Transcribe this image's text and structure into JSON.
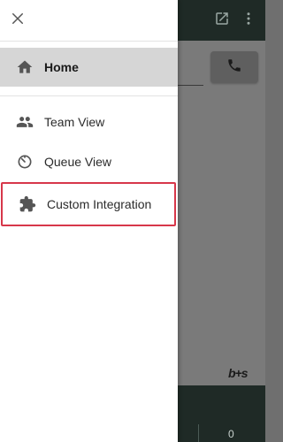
{
  "drawer": {
    "items": [
      {
        "label": "Home",
        "icon": "home-icon"
      },
      {
        "label": "Team View",
        "icon": "people-icon"
      },
      {
        "label": "Queue View",
        "icon": "timer-icon"
      },
      {
        "label": "Custom Integration",
        "icon": "puzzle-icon"
      }
    ]
  },
  "app": {
    "brand": "b+s",
    "bottom_count": "0"
  },
  "colors": {
    "drawer_bg": "#ffffff",
    "selected_bg": "#d6d6d6",
    "highlight_border": "#d7374a",
    "app_bar": "#1f2a26"
  }
}
